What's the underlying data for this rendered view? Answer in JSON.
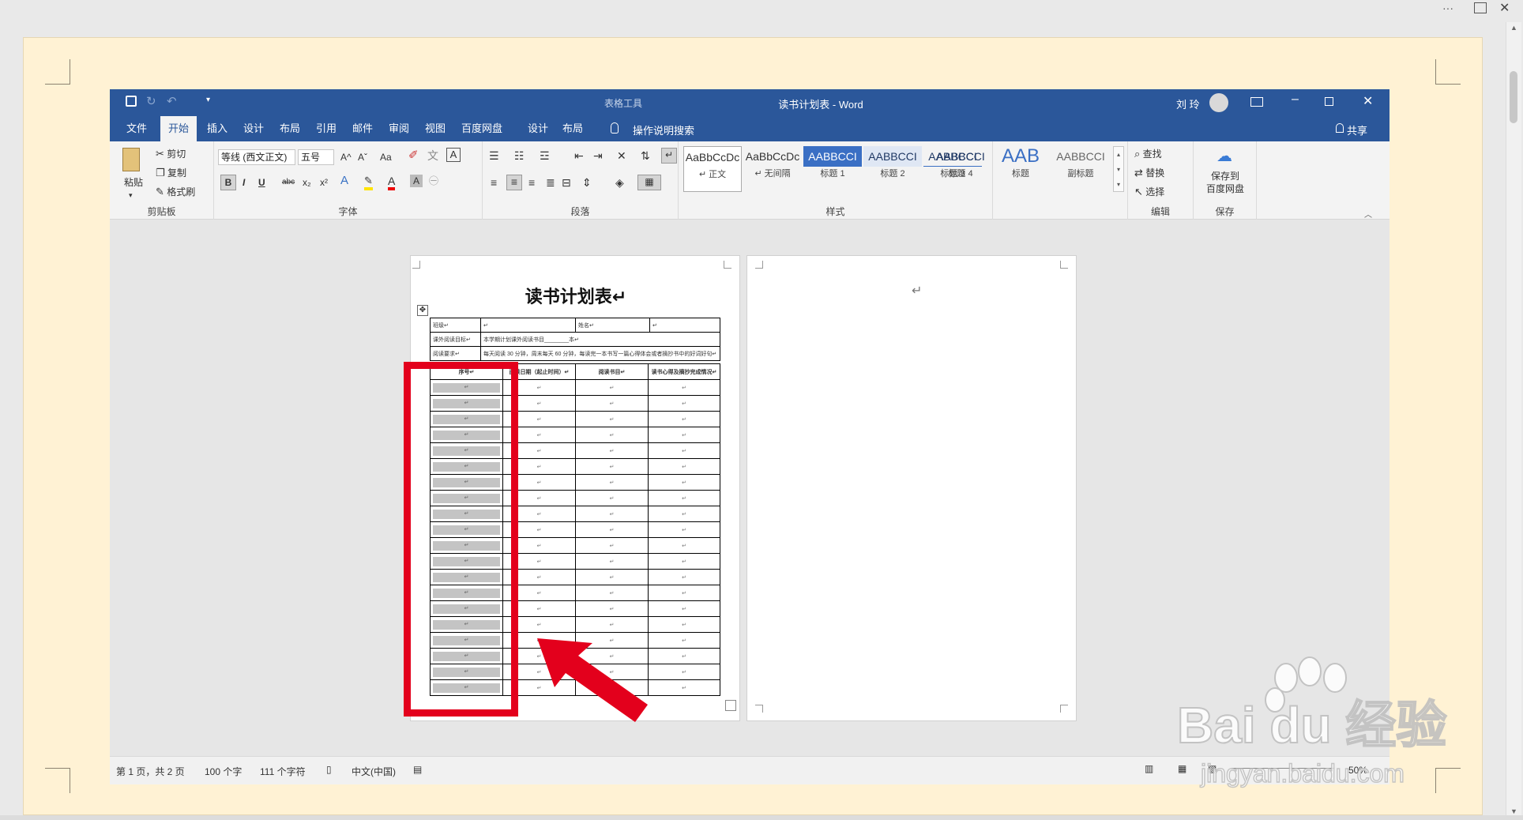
{
  "window": {
    "title": "读书计划表 - Word",
    "context_tool": "表格工具",
    "user": "刘 玲",
    "share_label": "共享"
  },
  "outer": {
    "menu_dots": "···"
  },
  "tabs": [
    "文件",
    "开始",
    "插入",
    "设计",
    "布局",
    "引用",
    "邮件",
    "审阅",
    "视图",
    "百度网盘",
    "设计",
    "布局"
  ],
  "tell_me": "操作说明搜索",
  "clipboard": {
    "paste": "粘贴",
    "cut": "剪切",
    "copy": "复制",
    "format_painter": "格式刷",
    "label": "剪贴板"
  },
  "font": {
    "family": "等线 (西文正文)",
    "size": "五号",
    "label": "字体",
    "bold": "B",
    "italic": "I",
    "underline": "U",
    "strike": "abc",
    "sub": "x₂",
    "sup": "x²",
    "grow": "A^",
    "shrink": "Aˇ",
    "case": "Aa"
  },
  "paragraph": {
    "label": "段落"
  },
  "styles": {
    "label": "样式",
    "items": [
      {
        "preview": "AaBbCcDc",
        "name": "↵ 正文"
      },
      {
        "preview": "AaBbCcDc",
        "name": "↵ 无间隔"
      },
      {
        "preview": "AABBCCI",
        "name": "标题 1"
      },
      {
        "preview": "AABBCCI",
        "name": "标题 2"
      },
      {
        "preview": "AABBCCI",
        "name": "标题 3"
      },
      {
        "preview": "AABBCCI",
        "name": "标题 4"
      },
      {
        "preview": "AAB",
        "name": "标题"
      },
      {
        "preview": "AABBCCI",
        "name": "副标题"
      }
    ]
  },
  "editing": {
    "find": "查找",
    "replace": "替换",
    "select": "选择",
    "label": "编辑"
  },
  "save": {
    "line1": "保存到",
    "line2": "百度网盘",
    "label": "保存"
  },
  "document": {
    "title": "读书计划表↵",
    "top_rows": [
      [
        "班级↵",
        "↵",
        "姓名↵",
        "↵"
      ],
      [
        "课外阅读目标↵",
        "本学期计划课外阅读书目________本↵"
      ],
      [
        "阅读要求↵",
        "每天阅读 30 分钟，周末每天 60 分钟，每读完一本书写一篇心得体会或者摘抄书中的好词好句↵"
      ]
    ],
    "headers": [
      "序号↵",
      "阅读日期（起止时间）↵",
      "阅读书目↵",
      "读书心得及摘抄完成情况↵"
    ],
    "cell_mark": "↵",
    "row_count": 20,
    "page2_mark": "↵"
  },
  "status": {
    "page": "第 1 页，共 2 页",
    "words": "100 个字",
    "chars": "111 个字符",
    "lang": "中文(中国)",
    "zoom": "50%"
  },
  "watermark": {
    "brand": "Bai du 经验",
    "url": "jingyan.baidu.com"
  },
  "colors": {
    "word_blue": "#2b579a",
    "highlight_red": "#e3001c"
  }
}
